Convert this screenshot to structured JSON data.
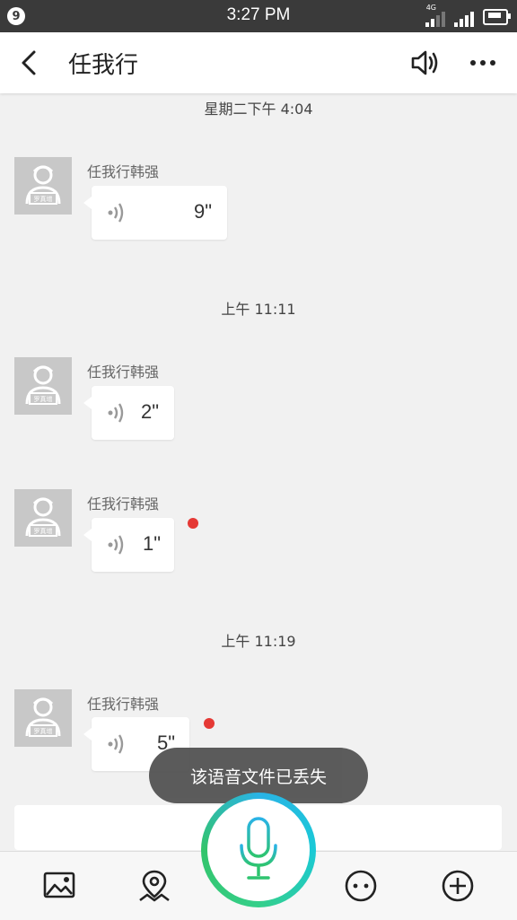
{
  "status_bar": {
    "badge": "9",
    "time": "3:27 PM",
    "network": "4G"
  },
  "header": {
    "title": "任我行"
  },
  "avatar_text": "罗真增",
  "messages": [
    {
      "timestamp": "星期二下午 4:04",
      "sender": "任我行韩强",
      "duration": "9\"",
      "unread": false
    },
    {
      "timestamp": "上午 11:11",
      "sender": "任我行韩强",
      "duration": "2\"",
      "unread": false
    },
    {
      "timestamp": "",
      "sender": "任我行韩强",
      "duration": "1\"",
      "unread": true
    },
    {
      "timestamp": "上午 11:19",
      "sender": "任我行韩强",
      "duration": "5\"",
      "unread": true
    }
  ],
  "toast": "该语音文件已丢失",
  "colors": {
    "status_bar": "#3a3a3a",
    "unread_dot": "#e53935",
    "mic_green": "#2ec46f",
    "mic_blue": "#2ab3e6"
  },
  "icons": [
    "back-arrow-icon",
    "speaker-icon",
    "more-icon",
    "voice-wave-icon",
    "image-icon",
    "location-icon",
    "microphone-icon",
    "emoji-icon",
    "add-icon"
  ]
}
